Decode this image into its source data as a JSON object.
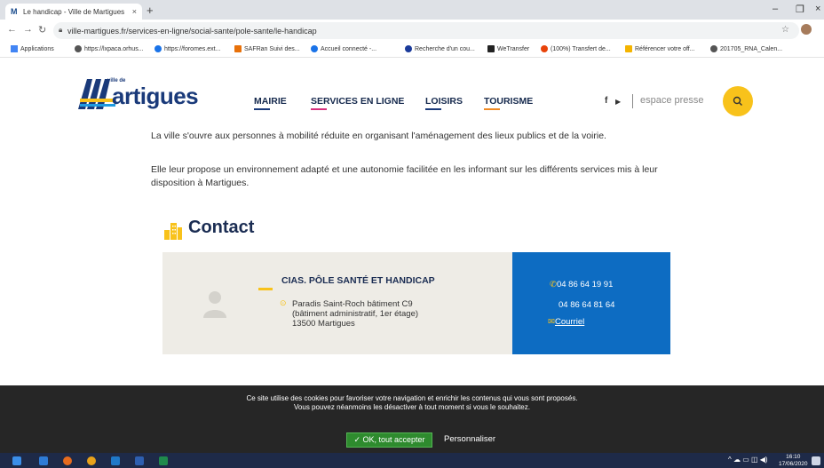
{
  "browser": {
    "tab_title": "Le handicap - Ville de Martigues",
    "tab_close": "×",
    "new_tab": "+",
    "win_min": "–",
    "win_max": "❐",
    "win_close": "×",
    "url": "ville-martigues.fr/services-en-ligne/social-sante/pole-sante/le-handicap",
    "bookmarks": [
      {
        "label": "Applications",
        "color": "#4285f4"
      },
      {
        "label": "https://lxpaca.orhus...",
        "color": "#555555"
      },
      {
        "label": "https://foromes.ext...",
        "color": "#1a73e8"
      },
      {
        "label": "SAFRan  Suivi des...",
        "color": "#e8710a"
      },
      {
        "label": "Accueil connecté -...",
        "color": "#1a73e8"
      },
      {
        "label": "Recherche d'un cou...",
        "color": "#1a3a9a"
      },
      {
        "label": "WeTransfer",
        "color": "#222222"
      },
      {
        "label": "(100%) Transfert de...",
        "color": "#e8430a"
      },
      {
        "label": "Référencer votre off...",
        "color": "#f4b400"
      },
      {
        "label": "201705_RNA_Calen...",
        "color": "#555555"
      }
    ]
  },
  "site": {
    "logo_small": "ville de",
    "logo_name": "artigues",
    "menu": [
      {
        "label": "MAIRIE",
        "color": "#1a3a7a"
      },
      {
        "label": "SERVICES EN LIGNE",
        "color": "#d62f7d"
      },
      {
        "label": "LOISIRS",
        "color": "#1a3a7a"
      },
      {
        "label": "TOURISME",
        "color": "#f08a24"
      }
    ],
    "facebook": "f",
    "youtube": "▶",
    "press": "espace presse",
    "accent": "#f8c21b"
  },
  "content": {
    "para1": "La ville s'ouvre aux personnes à mobilité réduite en organisant l'aménagement des lieux publics et de la voirie.",
    "para2": "Elle leur propose un environnement adapté et une autonomie facilitée en les informant sur les différents services mis à leur disposition à Martigues.",
    "contact_title": "Contact",
    "org_name": "CIAS. PÔLE SANTÉ ET HANDICAP",
    "address": [
      "Paradis Saint-Roch bâtiment C9",
      "(bâtiment administratif, 1er étage)",
      "13500 Martigues"
    ],
    "phone1": "04 86 64 19 91",
    "phone2": "04 86 64 81 64",
    "email_label": "Courriel"
  },
  "cookie": {
    "line1": "Ce site utilise des cookies pour favoriser votre navigation et enrichir les contenus qui vous sont proposés.",
    "line2": "Vous pouvez néanmoins les désactiver à tout moment si vous le souhaitez.",
    "accept": "✓ OK, tout accepter",
    "customize": "Personnaliser"
  },
  "taskbar": {
    "time": "16:10",
    "date": "17/06/2020"
  }
}
